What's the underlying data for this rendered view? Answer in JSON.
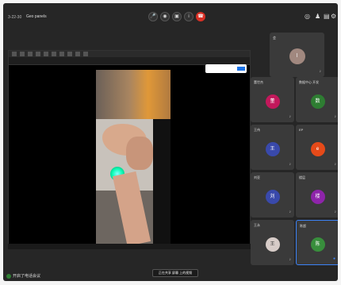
{
  "top": {
    "meeting_id": "3-22-30",
    "meeting_title": "Geo panels",
    "controls": [
      {
        "name": "mic-icon",
        "glyph": "🎤"
      },
      {
        "name": "camera-icon",
        "glyph": "◉"
      },
      {
        "name": "present-icon",
        "glyph": "▣"
      },
      {
        "name": "info-icon",
        "glyph": "i"
      },
      {
        "name": "end-call-icon",
        "glyph": "☎"
      }
    ],
    "right_icons": [
      {
        "name": "activity-icon",
        "glyph": "◎"
      },
      {
        "name": "people-icon",
        "glyph": "♟"
      },
      {
        "name": "chat-icon",
        "glyph": "▤"
      },
      {
        "name": "settings-icon",
        "glyph": "⚙"
      }
    ]
  },
  "host": {
    "name": "会",
    "avatar": "l"
  },
  "participants": [
    {
      "name": "董世杰",
      "avatar": "董",
      "color": "#c2185b"
    },
    {
      "name": "数据中心 开发",
      "avatar": "数",
      "color": "#2e7d32"
    },
    {
      "name": "王伟",
      "avatar": "王",
      "color": "#3949ab"
    },
    {
      "name": "EP",
      "avatar": "e",
      "color": "#e64a19"
    },
    {
      "name": "刘亚",
      "avatar": "刘",
      "color": "#3949ab"
    },
    {
      "name": "楼层",
      "avatar": "楼",
      "color": "#8e24aa"
    },
    {
      "name": "王永",
      "avatar": "王",
      "color": "#d7ccc8"
    },
    {
      "name": "陈超",
      "avatar": "陈",
      "color": "#388e3c"
    }
  ],
  "bottom": {
    "status": "开启了电话会议",
    "toast": "正在共享 屏幕 上的视频"
  },
  "colors": {
    "accent": "#3c82f6",
    "end_call": "#d93025"
  }
}
